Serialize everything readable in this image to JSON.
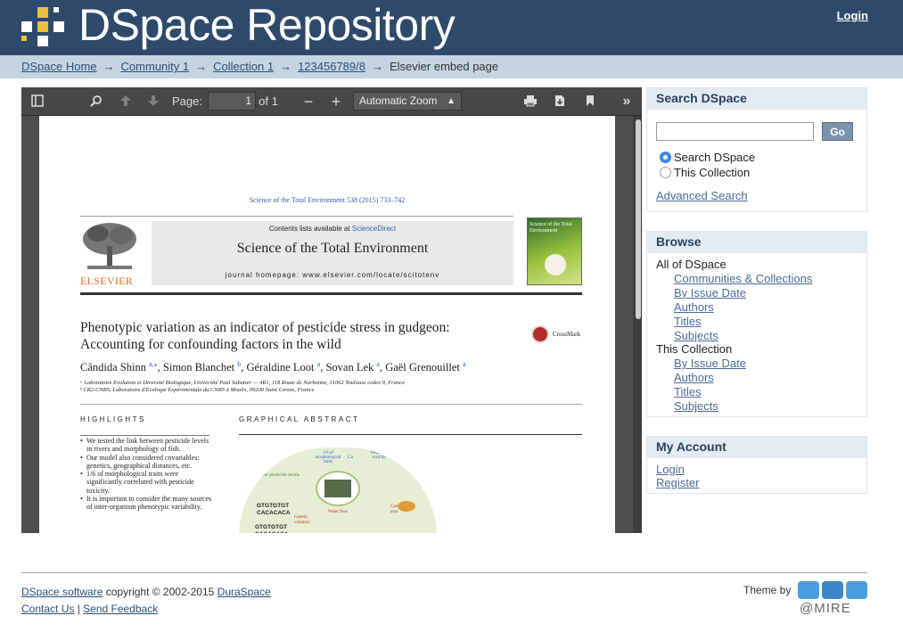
{
  "header": {
    "site_title": "DSpace Repository",
    "login_label": "Login"
  },
  "breadcrumb": {
    "items": [
      "DSpace Home",
      "Community 1",
      "Collection 1",
      "123456789/8"
    ],
    "current": "Elsevier embed page",
    "separator": "→"
  },
  "viewer": {
    "page_label": "Page:",
    "page_value": "1",
    "page_of": "of 1",
    "zoom_value": "Automatic Zoom",
    "icons": [
      "sidebar-toggle-icon",
      "search-icon",
      "page-up-icon",
      "page-down-icon",
      "zoom-out-icon",
      "zoom-in-icon",
      "print-icon",
      "download-icon",
      "bookmark-icon",
      "tools-icon"
    ]
  },
  "document": {
    "citation": "Science of the Total Environment 538 (2015) 733–742",
    "publisher": "ELSEVIER",
    "contents_prefix": "Contents lists available at ",
    "contents_link": "ScienceDirect",
    "journal_title": "Science of the Total Environment",
    "journal_home": "journal homepage: www.elsevier.com/locate/scitotenv",
    "cover_title": "Science of the Total Environment",
    "title_line1": "Phenotypic variation as an indicator of pesticide stress in gudgeon:",
    "title_line2": "Accounting for confounding factors in the wild",
    "crossmark": "CrossMark",
    "authors": [
      {
        "name": "Cândida Shinn",
        "sup": "a,⁎"
      },
      {
        "name": "Simon Blanchet",
        "sup": "b"
      },
      {
        "name": "Géraldine Loot",
        "sup": "a"
      },
      {
        "name": "Sovan Lek",
        "sup": "a"
      },
      {
        "name": "Gaël Grenouillet",
        "sup": "a"
      }
    ],
    "affiliation_a": "ᵃ Laboratoire Evolution et Diversité Biologique, Université Paul Sabatier — 4R1, 118 Route de Narbonne, 31062 Toulouse cedex 9, France",
    "affiliation_b": "ᵇ CR2-CNRS, Laboratoire d'Ecologie Expérimentale du CNRS à Moulis, 09200 Saint Girons, France",
    "highlights_heading": "HIGHLIGHTS",
    "highlights": [
      "We tested the link between pesticide levels in rivers and morphology of fish.",
      "Our model also considered covariables: genetics, geographical distances, etc.",
      "1/6 of morphological traits were significantly correlated with pesticide toxicity.",
      "It is important to consider the many sources of inter-organism phenotypic variability."
    ],
    "graphical_abstract_heading": "GRAPHICAL ABSTRACT",
    "ga_labels": {
      "water_pesticide": "Water pesticide levels",
      "morphology": "1/6 of morphological traits",
      "co": "Co",
      "pesticide_toxicity": "Pesticide toxicity",
      "dna1": "GTGTGTGT\nCACACACA",
      "dna2": "GTGTGTGT\nCACACACA",
      "genetic": "Genetic\nvariation",
      "water_flow": "Water flow",
      "catchment": "Catchment\narea"
    }
  },
  "sidebar": {
    "search": {
      "heading": "Search DSpace",
      "input_value": "",
      "go_label": "Go",
      "scope_options": [
        "Search DSpace",
        "This Collection"
      ],
      "selected_scope": "Search DSpace",
      "advanced_label": "Advanced Search"
    },
    "browse": {
      "heading": "Browse",
      "all_label": "All of DSpace",
      "all_links": [
        "Communities & Collections",
        "By Issue Date",
        "Authors",
        "Titles",
        "Subjects"
      ],
      "collection_label": "This Collection",
      "collection_links": [
        "By Issue Date",
        "Authors",
        "Titles",
        "Subjects"
      ]
    },
    "account": {
      "heading": "My Account",
      "links": [
        "Login",
        "Register"
      ]
    }
  },
  "footer": {
    "dspace_link": "DSpace software",
    "copyright": " copyright © 2002-2015 ",
    "duraspace_link": "DuraSpace",
    "contact_link": "Contact Us",
    "separator": " | ",
    "feedback_link": "Send Feedback",
    "theme_by": "Theme by",
    "theme_logo_text": "@MIRE"
  },
  "colors": {
    "header_bg": "#2e4a6b",
    "trail_bg": "#c5d4e3",
    "link": "#4a6b96",
    "go_button": "#7d93ab"
  }
}
